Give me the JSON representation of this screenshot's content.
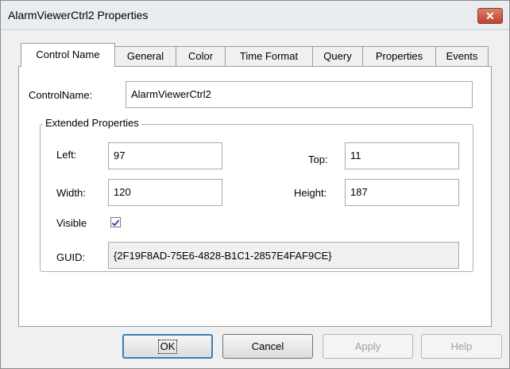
{
  "window": {
    "title": "AlarmViewerCtrl2 Properties",
    "close_label": "✕"
  },
  "tabs": [
    "Control Name",
    "General",
    "Color",
    "Time Format",
    "Query",
    "Properties",
    "Events"
  ],
  "form": {
    "control_name_label": "ControlName:",
    "control_name_value": "AlarmViewerCtrl2",
    "group_title": "Extended Properties",
    "left_label": "Left:",
    "left_value": "97",
    "top_label": "Top:",
    "top_value": "11",
    "width_label": "Width:",
    "width_value": "120",
    "height_label": "Height:",
    "height_value": "187",
    "visible_label": "Visible",
    "visible_checked": true,
    "guid_label": "GUID:",
    "guid_value": "{2F19F8AD-75E6-4828-B1C1-2857E4FAF9CE}"
  },
  "buttons": {
    "ok": "OK",
    "cancel": "Cancel",
    "apply": "Apply",
    "help": "Help"
  }
}
